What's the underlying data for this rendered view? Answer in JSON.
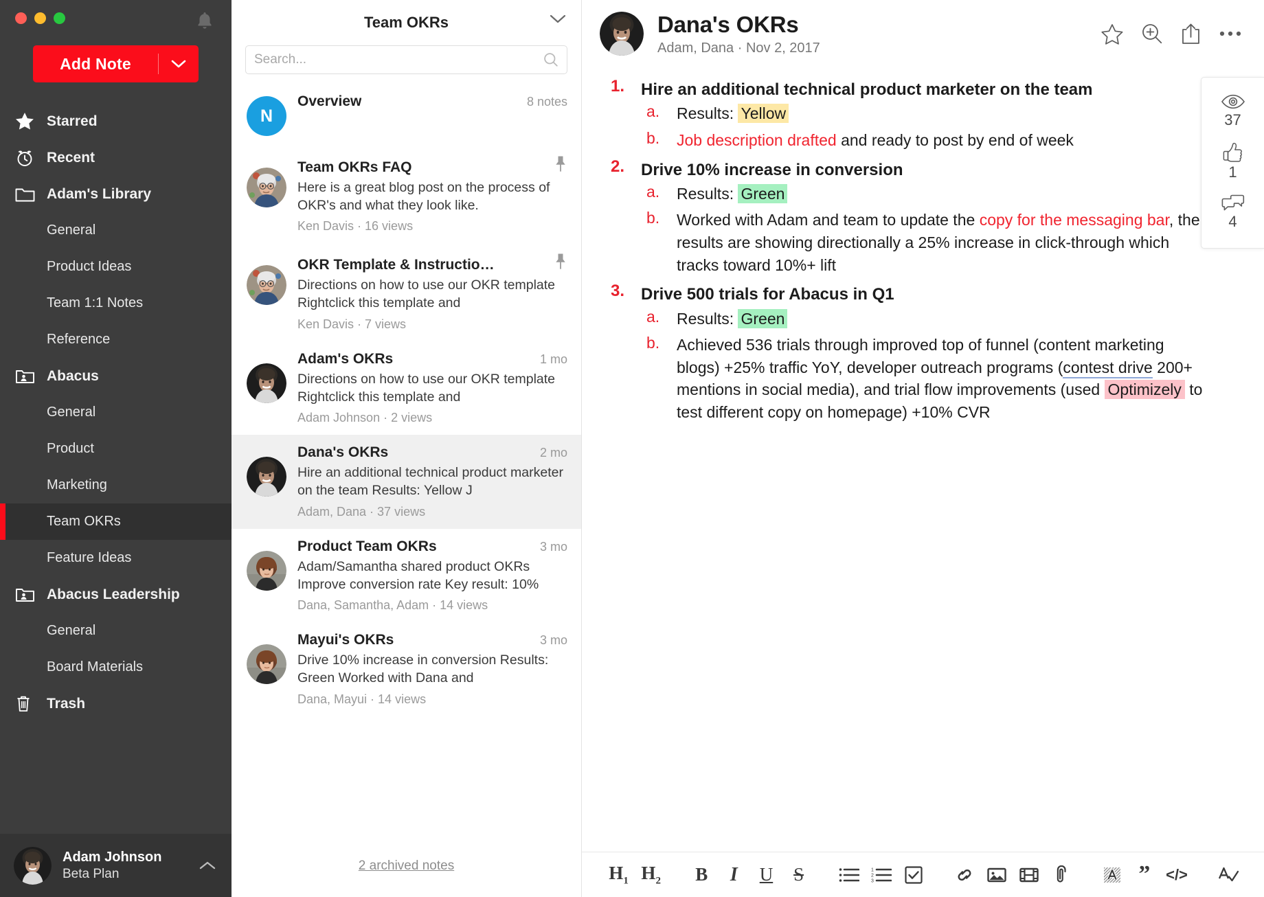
{
  "window": {
    "traffic_lights": [
      "close",
      "minimize",
      "maximize"
    ],
    "notification_icon": "bell-icon"
  },
  "sidebar": {
    "add_note_label": "Add Note",
    "nav": [
      {
        "label": "Starred",
        "icon": "star-icon",
        "level": "top",
        "selected": false
      },
      {
        "label": "Recent",
        "icon": "clock-icon",
        "level": "top",
        "selected": false
      },
      {
        "label": "Adam's Library",
        "icon": "folder-icon",
        "level": "top",
        "selected": false
      },
      {
        "label": "General",
        "icon": "",
        "level": "child",
        "selected": false
      },
      {
        "label": "Product Ideas",
        "icon": "",
        "level": "child",
        "selected": false
      },
      {
        "label": "Team 1:1 Notes",
        "icon": "",
        "level": "child",
        "selected": false
      },
      {
        "label": "Reference",
        "icon": "",
        "level": "child",
        "selected": false
      },
      {
        "label": "Abacus",
        "icon": "shared-folder-icon",
        "level": "top",
        "selected": false
      },
      {
        "label": "General",
        "icon": "",
        "level": "child",
        "selected": false
      },
      {
        "label": "Product",
        "icon": "",
        "level": "child",
        "selected": false
      },
      {
        "label": "Marketing",
        "icon": "",
        "level": "child",
        "selected": false
      },
      {
        "label": "Team OKRs",
        "icon": "",
        "level": "child",
        "selected": true
      },
      {
        "label": "Feature Ideas",
        "icon": "",
        "level": "child",
        "selected": false
      },
      {
        "label": "Abacus Leadership",
        "icon": "shared-folder-icon",
        "level": "top",
        "selected": false
      },
      {
        "label": "General",
        "icon": "",
        "level": "child",
        "selected": false
      },
      {
        "label": "Board Materials",
        "icon": "",
        "level": "child",
        "selected": false
      },
      {
        "label": "Trash",
        "icon": "trash-icon",
        "level": "top",
        "selected": false
      }
    ],
    "user": {
      "name": "Adam Johnson",
      "plan": "Beta Plan",
      "avatar": "adam-avatar",
      "expand_icon": "chevron-up-icon"
    }
  },
  "notelist": {
    "title": "Team OKRs",
    "collapse_icon": "chevron-down-icon",
    "search": {
      "placeholder": "Search...",
      "value": "",
      "icon": "search-icon"
    },
    "items": [
      {
        "badge": "N",
        "title": "Overview",
        "snippet": "",
        "byline": "",
        "meta_right": "8 notes",
        "pinned": false,
        "active": false,
        "avatar": "none"
      },
      {
        "badge": "",
        "title": "Team OKRs FAQ",
        "snippet": "Here is a great blog post on the process of OKR's and what they look like.",
        "byline": "Ken Davis · 16 views",
        "meta_right": "",
        "pinned": true,
        "active": false,
        "avatar": "ken-avatar"
      },
      {
        "badge": "",
        "title": "OKR Template & Instructio…",
        "snippet": "Directions on how to use our OKR template Rightclick this template and",
        "byline": "Ken Davis · 7 views",
        "meta_right": "",
        "pinned": true,
        "active": false,
        "avatar": "ken-avatar"
      },
      {
        "badge": "",
        "title": "Adam's OKRs",
        "snippet": "Directions on how to use our OKR template Rightclick this template and",
        "byline": "Adam Johnson · 2 views",
        "meta_right": "1 mo",
        "pinned": false,
        "active": false,
        "avatar": "adam-avatar"
      },
      {
        "badge": "",
        "title": "Dana's OKRs",
        "snippet": "Hire an additional technical product marketer on the team Results: Yellow J",
        "byline": "Adam, Dana · 37 views",
        "meta_right": "2 mo",
        "pinned": false,
        "active": true,
        "avatar": "dana-avatar"
      },
      {
        "badge": "",
        "title": "Product Team OKRs",
        "snippet": "Adam/Samantha shared product OKRs Improve conversion rate Key result: 10%",
        "byline": "Dana, Samantha, Adam · 14 views",
        "meta_right": "3 mo",
        "pinned": false,
        "active": false,
        "avatar": "samantha-avatar"
      },
      {
        "badge": "",
        "title": "Mayui's OKRs",
        "snippet": "Drive 10% increase in conversion Results: Green Worked with Dana and",
        "byline": "Dana, Mayui · 14 views",
        "meta_right": "3 mo",
        "pinned": false,
        "active": false,
        "avatar": "samantha-avatar"
      }
    ],
    "archived_link": "2 archived notes"
  },
  "note": {
    "title": "Dana's OKRs",
    "subtitle": "Adam, Dana · Nov 2, 2017",
    "avatar": "dana-avatar",
    "actions": [
      {
        "name": "star-icon",
        "label": "Star"
      },
      {
        "name": "zoom-in-icon",
        "label": "Zoom"
      },
      {
        "name": "share-icon",
        "label": "Share"
      },
      {
        "name": "more-icon",
        "label": "More"
      }
    ],
    "objectives": [
      {
        "marker": "1.",
        "text": "Hire an additional technical product marketer on the team",
        "key_results": [
          {
            "marker": "a.",
            "prefix": "Results: ",
            "highlight": "Yellow",
            "highlight_color": "yellow",
            "suffix": ""
          },
          {
            "marker": "b.",
            "prefix": "",
            "link": "Job description drafted",
            "suffix": " and ready to post by end of week"
          }
        ]
      },
      {
        "marker": "2.",
        "text": "Drive 10% increase in conversion",
        "key_results": [
          {
            "marker": "a.",
            "prefix": "Results: ",
            "highlight": "Green",
            "highlight_color": "green",
            "suffix": ""
          },
          {
            "marker": "b.",
            "prefix": "Worked with Adam and team to update the ",
            "link": "copy for the messaging bar",
            "suffix": ", the results are showing directionally a 25% increase in click-through which tracks toward 10%+ lift"
          }
        ]
      },
      {
        "marker": "3.",
        "text": "Drive 500 trials for Abacus in Q1",
        "key_results": [
          {
            "marker": "a.",
            "prefix": "Results: ",
            "highlight": "Green",
            "highlight_color": "green",
            "suffix": ""
          },
          {
            "marker": "b.",
            "prefix": "Achieved 536 trials through improved top of funnel (content marketing blogs) +25% traffic YoY,  developer outreach programs (",
            "underline": "contest drive",
            "mid": " 200+ mentions in social media), and trial flow improvements (used ",
            "highlight": "Optimizely",
            "highlight_color": "pink",
            "suffix": " to test different copy on homepage) +10% CVR"
          }
        ]
      }
    ],
    "stats": [
      {
        "icon": "eye-icon",
        "value": "37"
      },
      {
        "icon": "thumbs-up-icon",
        "value": "1"
      },
      {
        "icon": "comments-icon",
        "value": "4"
      }
    ],
    "toolbar": [
      {
        "name": "heading-1-button",
        "kind": "h1"
      },
      {
        "name": "heading-2-button",
        "kind": "h2"
      },
      {
        "name": "bold-button",
        "kind": "bold"
      },
      {
        "name": "italic-button",
        "kind": "italic"
      },
      {
        "name": "underline-button",
        "kind": "underline"
      },
      {
        "name": "strikethrough-button",
        "kind": "strike"
      },
      {
        "name": "bulleted-list-button",
        "kind": "ul"
      },
      {
        "name": "numbered-list-button",
        "kind": "ol"
      },
      {
        "name": "checklist-button",
        "kind": "check"
      },
      {
        "name": "link-button",
        "kind": "link"
      },
      {
        "name": "image-button",
        "kind": "image"
      },
      {
        "name": "video-button",
        "kind": "video"
      },
      {
        "name": "attachment-button",
        "kind": "clip"
      },
      {
        "name": "highlight-button",
        "kind": "highlight"
      },
      {
        "name": "quote-button",
        "kind": "quote"
      },
      {
        "name": "code-button",
        "kind": "code"
      },
      {
        "name": "spellcheck-button",
        "kind": "spell"
      }
    ]
  },
  "colors": {
    "accent_red": "#fb0d1b",
    "sidebar_bg": "#3d3d3d",
    "selected_row": "#f0f0f0",
    "badge_blue": "#1a9fe0",
    "highlight_yellow": "#fde8a6",
    "highlight_green": "#a5f0c0",
    "highlight_pink": "#fcc2c9",
    "link_red": "#f0242f"
  }
}
